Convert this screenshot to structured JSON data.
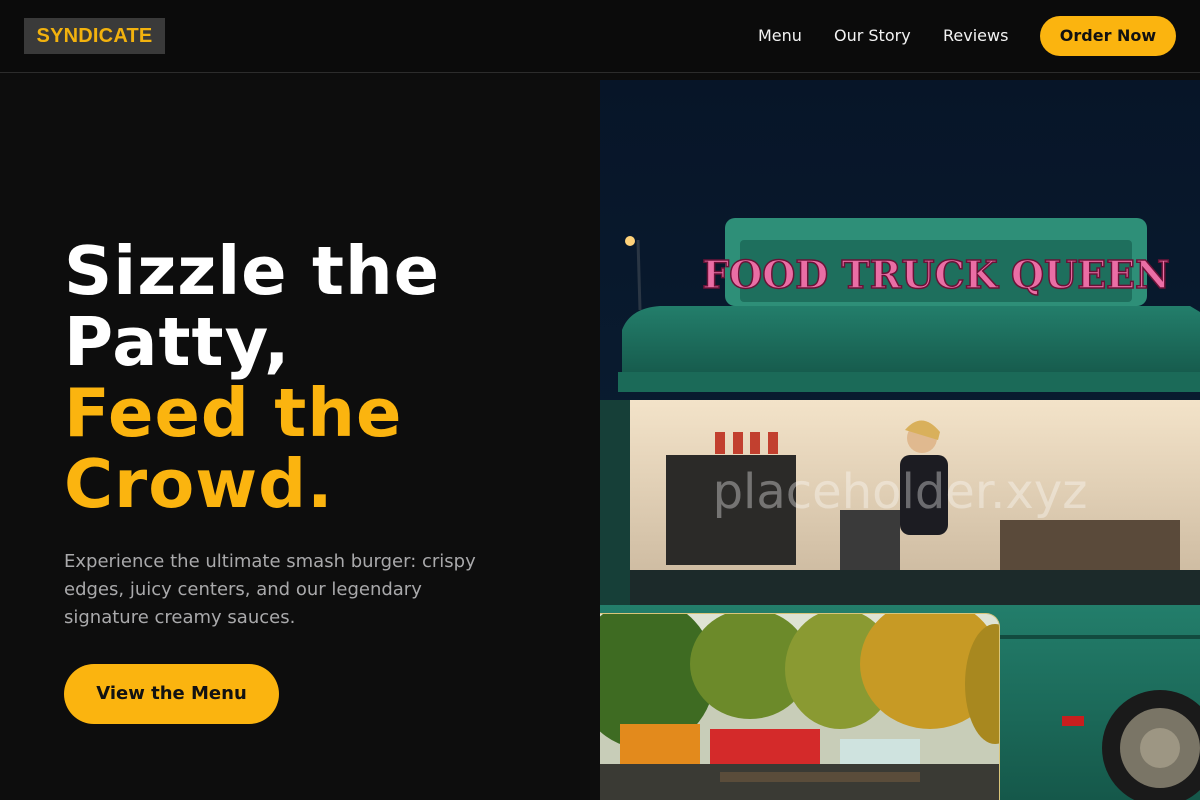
{
  "header": {
    "logo": "SYNDICATE",
    "nav": {
      "menu": "Menu",
      "story": "Our Story",
      "reviews": "Reviews"
    },
    "order_label": "Order Now"
  },
  "hero": {
    "headline_line1": "Sizzle the",
    "headline_line2": "Patty,",
    "headline_line3": "Feed the",
    "headline_line4": "Crowd.",
    "subtext": "Experience the ultimate smash burger: crispy edges, juicy centers, and our legendary signature creamy sauces.",
    "cta_label": "View the Menu"
  },
  "images": {
    "truck_sign": "FOOD TRUCK QUEEN",
    "watermark": "placeholder.xyz"
  },
  "colors": {
    "accent": "#fbb40f",
    "background": "#0d0d0d",
    "truck_teal": "#1f7a66"
  }
}
